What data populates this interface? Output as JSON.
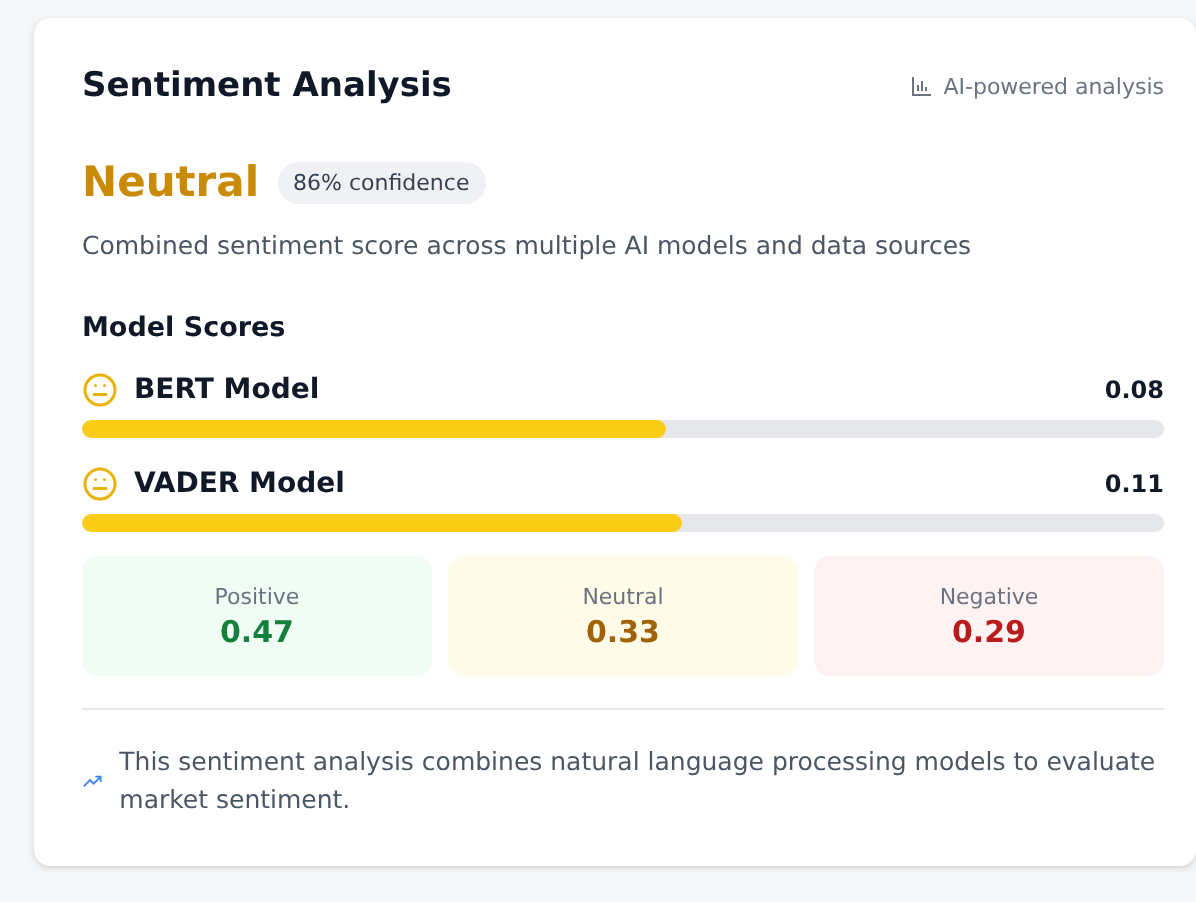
{
  "card": {
    "title": "Sentiment Analysis",
    "badge": "AI-powered analysis"
  },
  "overall": {
    "label": "Neutral",
    "confidence": "86% confidence",
    "description": "Combined sentiment score across multiple AI models and data sources"
  },
  "model_scores": {
    "heading": "Model Scores",
    "models": [
      {
        "name": "BERT Model",
        "score": "0.08",
        "level": 0.54
      },
      {
        "name": "VADER Model",
        "score": "0.11",
        "level": 0.555
      }
    ]
  },
  "breakdown": [
    {
      "kind": "positive",
      "label": "Positive",
      "value": "0.47"
    },
    {
      "kind": "neutral",
      "label": "Neutral",
      "value": "0.33"
    },
    {
      "kind": "negative",
      "label": "Negative",
      "value": "0.29"
    }
  ],
  "footer": "This sentiment analysis combines natural language processing models to evaluate market sentiment."
}
